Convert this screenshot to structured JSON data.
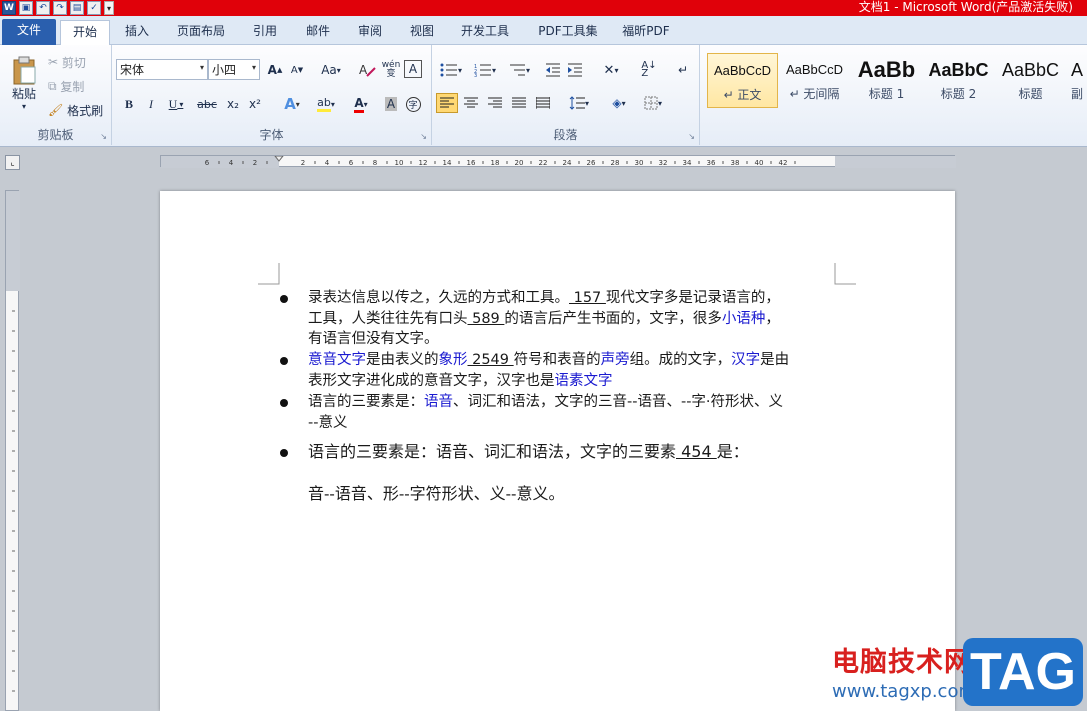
{
  "window": {
    "title": "文档1 - Microsoft Word(产品激活失败)"
  },
  "qat": {
    "word_icon": "W"
  },
  "tabs": [
    {
      "label": "文件"
    },
    {
      "label": "开始"
    },
    {
      "label": "插入"
    },
    {
      "label": "页面布局"
    },
    {
      "label": "引用"
    },
    {
      "label": "邮件"
    },
    {
      "label": "审阅"
    },
    {
      "label": "视图"
    },
    {
      "label": "开发工具"
    },
    {
      "label": "PDF工具集"
    },
    {
      "label": "福昕PDF"
    }
  ],
  "ribbon": {
    "clipboard": {
      "label": "剪贴板",
      "paste": "粘贴",
      "cut": "剪切",
      "copy": "复制",
      "format_painter": "格式刷"
    },
    "font": {
      "label": "字体",
      "name": "宋体",
      "size": "小四",
      "bold": "B",
      "italic": "I",
      "underline": "U",
      "strike": "abc",
      "sub": "x₂",
      "sup": "x²",
      "case": "Aa",
      "grow": "A",
      "shrink": "A",
      "text_effect": "A",
      "highlight": "ab",
      "font_color": "A",
      "char_shade": "A",
      "pinyin": "wén",
      "clear": "A"
    },
    "paragraph": {
      "label": "段落"
    },
    "styles": [
      {
        "sample": "AaBbCcD",
        "name": "↵ 正文"
      },
      {
        "sample": "AaBbCcD",
        "name": "↵ 无间隔"
      },
      {
        "sample": "AaBb",
        "name": "标题 1"
      },
      {
        "sample": "AaBbC",
        "name": "标题 2"
      },
      {
        "sample": "AaBbC",
        "name": "标题"
      },
      {
        "sample": "A",
        "name": "副"
      }
    ]
  },
  "ruler": {
    "marks": [
      "6",
      "4",
      "2",
      "2",
      "4",
      "6",
      "8",
      "10",
      "12",
      "14",
      "16",
      "18",
      "20",
      "22",
      "24",
      "26",
      "28",
      "30",
      "32",
      "34",
      "36",
      "38",
      "40",
      "42"
    ]
  },
  "doc": {
    "item1": {
      "line1_a": "录表达信息以传之，久远的方式和工具。",
      "num1": " 157 ",
      "line1_b": "现代文字多是记录语言的，",
      "line2_a": "工具，人类往往先有口头",
      "num2": " 589 ",
      "line2_b": "的语言后产生书面的，文字，很多",
      "link1": "小语种",
      "line2_c": "，",
      "line3": "有语言但没有文字。"
    },
    "item2": {
      "link1": "意音文字",
      "t1": "是由表义的",
      "link2": "象形",
      "num1": " 2549 ",
      "t2": "符号和表音的",
      "link3": "声旁",
      "t3": "组。成的文字，",
      "link4": "汉字",
      "t4": "是由",
      "line2_a": "表形文字进化成的意音文字，汉字也是",
      "link5": "语素文字"
    },
    "item3": {
      "t1": "语言的三要素是：",
      "link1": "语音",
      "t2": "、词汇和语法，文字的三音--语音、--字·符形状、义",
      "line2": "--意义"
    },
    "item4": {
      "t1": "语言的三要素是：语音、词汇和语法，文字的三要素",
      "num1": " 454 ",
      "t2": "是：",
      "line2": "音--语音、形--字符形状、义--意义。"
    }
  },
  "watermark": {
    "site": "电脑技术网",
    "url": "www.tagxp.com",
    "logo": "TAG"
  }
}
